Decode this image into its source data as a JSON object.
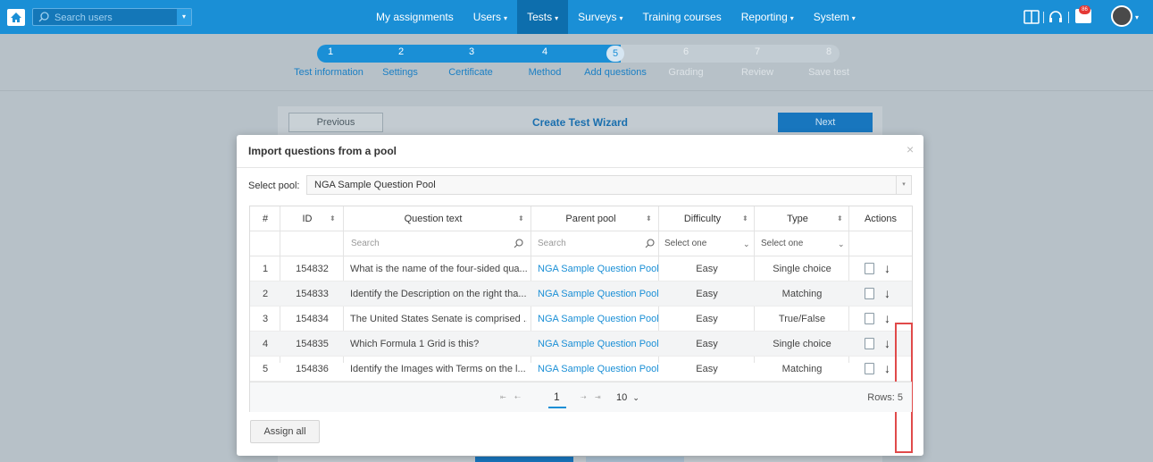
{
  "topbar": {
    "search_placeholder": "Search users",
    "nav": [
      {
        "label": "My assignments",
        "caret": ""
      },
      {
        "label": "Users",
        "caret": "▾"
      },
      {
        "label": "Tests",
        "caret": "▾"
      },
      {
        "label": "Surveys",
        "caret": "▾"
      },
      {
        "label": "Training courses",
        "caret": ""
      },
      {
        "label": "Reporting",
        "caret": "▾"
      },
      {
        "label": "System",
        "caret": "▾"
      }
    ],
    "active_nav": "Tests",
    "separator": "|",
    "notification_count": "86",
    "brand_color": "#1a8fd6"
  },
  "wizard": {
    "steps": [
      {
        "num": "1",
        "label": "Test information"
      },
      {
        "num": "2",
        "label": "Settings"
      },
      {
        "num": "3",
        "label": "Certificate"
      },
      {
        "num": "4",
        "label": "Method"
      },
      {
        "num": "5",
        "label": "Add questions"
      },
      {
        "num": "6",
        "label": "Grading"
      },
      {
        "num": "7",
        "label": "Review"
      },
      {
        "num": "8",
        "label": "Save test"
      }
    ],
    "current_step": 5,
    "previous_label": "Previous",
    "title": "Create Test Wizard",
    "next_label": "Next"
  },
  "modal": {
    "title": "Import questions from a pool",
    "close": "×",
    "pool_label": "Select pool:",
    "pool_value": "NGA Sample Question Pool",
    "columns": [
      "#",
      "ID",
      "Question text",
      "Parent pool",
      "Difficulty",
      "Type",
      "Actions"
    ],
    "filters": {
      "question_placeholder": "Search",
      "pool_placeholder": "Search",
      "difficulty_placeholder": "Select one",
      "type_placeholder": "Select one"
    },
    "rows": [
      {
        "num": "1",
        "id": "154832",
        "question": "What is the name of the four-sided qua...",
        "pool": "NGA Sample Question Pool",
        "difficulty": "Easy",
        "type": "Single choice"
      },
      {
        "num": "2",
        "id": "154833",
        "question": "Identify the Description on the right tha...",
        "pool": "NGA Sample Question Pool",
        "difficulty": "Easy",
        "type": "Matching"
      },
      {
        "num": "3",
        "id": "154834",
        "question": "The United States Senate is comprised ...",
        "pool": "NGA Sample Question Pool",
        "difficulty": "Easy",
        "type": "True/False"
      },
      {
        "num": "4",
        "id": "154835",
        "question": "Which Formula 1 Grid is this?",
        "pool": "NGA Sample Question Pool",
        "difficulty": "Easy",
        "type": "Single choice"
      },
      {
        "num": "5",
        "id": "154836",
        "question": "Identify the Images with Terms on the l...",
        "pool": "NGA Sample Question Pool",
        "difficulty": "Easy",
        "type": "Matching"
      }
    ],
    "pager": {
      "first": "⇤",
      "prev": "⇠",
      "page": "1",
      "next": "⇢",
      "last": "⇥",
      "page_size": "10",
      "rows_label": "Rows: 5"
    },
    "assign_all_label": "Assign all"
  }
}
